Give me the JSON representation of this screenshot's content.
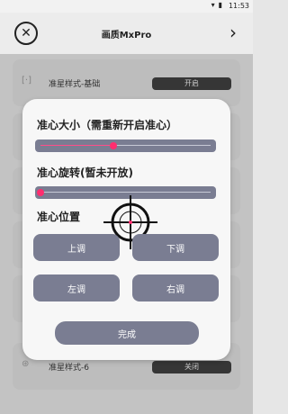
{
  "status": {
    "time": "11:53"
  },
  "header": {
    "title": "画质MxPro"
  },
  "rows": [
    {
      "label": "准星样式-基础",
      "toggle": "开启"
    },
    {
      "label": "",
      "toggle": ""
    },
    {
      "label": "",
      "toggle": ""
    },
    {
      "label": "",
      "toggle": ""
    },
    {
      "label": "",
      "toggle": ""
    },
    {
      "label": "准星样式-6",
      "toggle": "关闭"
    }
  ],
  "dialog": {
    "size_label": "准心大小（需重新开启准心）",
    "size_value": 0.43,
    "rotate_label": "准心旋转(暂未开放)",
    "rotate_value": 0.0,
    "position_label": "准心位置",
    "buttons": {
      "up": "上调",
      "down": "下调",
      "left": "左调",
      "right": "右调"
    },
    "done_label": "完成"
  },
  "colors": {
    "accent": "#ff2d6f",
    "button": "#7a7d92"
  }
}
